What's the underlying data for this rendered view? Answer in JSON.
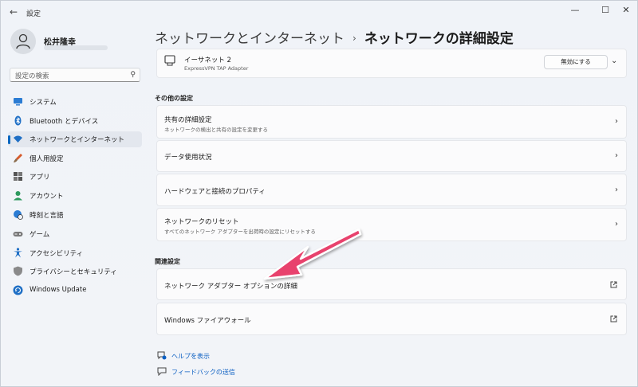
{
  "window": {
    "app_title": "設定",
    "back_glyph": "←",
    "minimize_glyph": "—",
    "maximize_glyph": "☐",
    "close_glyph": "✕"
  },
  "profile": {
    "name": "松井隆幸"
  },
  "search": {
    "placeholder": "設定の検索",
    "icon_glyph": "⚲"
  },
  "sidebar": {
    "items": [
      {
        "label": "システム",
        "icon": "system-icon"
      },
      {
        "label": "Bluetooth とデバイス",
        "icon": "bluetooth-icon"
      },
      {
        "label": "ネットワークとインターネット",
        "icon": "wifi-icon",
        "active": true
      },
      {
        "label": "個人用設定",
        "icon": "paintbrush-icon"
      },
      {
        "label": "アプリ",
        "icon": "apps-icon"
      },
      {
        "label": "アカウント",
        "icon": "account-icon"
      },
      {
        "label": "時刻と言語",
        "icon": "globe-clock-icon"
      },
      {
        "label": "ゲーム",
        "icon": "gamepad-icon"
      },
      {
        "label": "アクセシビリティ",
        "icon": "accessibility-icon"
      },
      {
        "label": "プライバシーとセキュリティ",
        "icon": "shield-icon"
      },
      {
        "label": "Windows Update",
        "icon": "update-icon"
      }
    ]
  },
  "breadcrumb": {
    "parent": "ネットワークとインターネット",
    "separator": "›",
    "current": "ネットワークの詳細設定"
  },
  "adapter": {
    "name": "イーサネット 2",
    "description": "ExpressVPN TAP Adapter",
    "disable_label": "無効にする",
    "expand_glyph": "⌄"
  },
  "other_settings": {
    "heading": "その他の設定",
    "items": [
      {
        "title": "共有の詳細設定",
        "subtitle": "ネットワークの検出と共有の設定を変更する"
      },
      {
        "title": "データ使用状況",
        "subtitle": ""
      },
      {
        "title": "ハードウェアと接続のプロパティ",
        "subtitle": ""
      },
      {
        "title": "ネットワークのリセット",
        "subtitle": "すべてのネットワーク アダプターを出荷時の設定にリセットする"
      }
    ]
  },
  "related_settings": {
    "heading": "関連設定",
    "items": [
      {
        "title": "ネットワーク アダプター オプションの詳細"
      },
      {
        "title": "Windows ファイアウォール"
      }
    ]
  },
  "footer_links": {
    "help": "ヘルプを表示",
    "feedback": "フィードバックの送信"
  },
  "chevron_glyph": "›",
  "colors": {
    "accent": "#0067c0",
    "annotation_arrow": "#e8436d",
    "link": "#0a5ec2"
  }
}
